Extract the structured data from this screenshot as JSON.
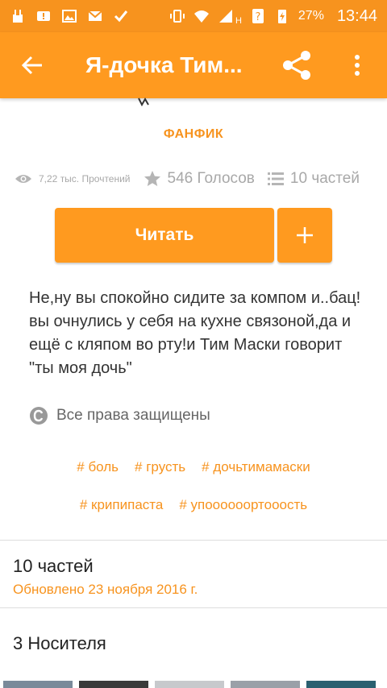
{
  "status_bar": {
    "battery": "27%",
    "time": "13:44",
    "network_label": "H",
    "icons": [
      "rock-hand-icon",
      "alert-icon",
      "image-icon",
      "gmail-icon",
      "check-icon",
      "vibrate-icon",
      "wifi-icon",
      "signal-icon",
      "question-icon",
      "battery-icon"
    ]
  },
  "app_bar": {
    "title": "Я-дочка Тим...",
    "icons": [
      "back-arrow-icon",
      "share-icon",
      "more-vert-icon"
    ]
  },
  "story": {
    "type": "ФАНФИК",
    "reads": "7,22 тыс. Прочтений",
    "votes": "546 Голосов",
    "parts": "10 частей",
    "read_button": "Читать",
    "add_button": "+",
    "description": "Не,ну вы спокойно сидите за компом и..бац!вы очнулись у себя на кухне связоной,да и ещё с кляпом во рту!и Тим Маски говорит \"ты моя дочь\"",
    "copyright": "Все права защищены",
    "tags_row1": [
      "# боль",
      "# грусть",
      "# дочьтимамаски"
    ],
    "tags_row2": [
      "# крипипаста",
      "# упоооооортооость"
    ]
  },
  "parts_section": {
    "title": "10 частей",
    "updated": "Обновлено 23 ноября 2016 г."
  },
  "readers_section": {
    "title": "3 Носителя"
  },
  "colors": {
    "accent": "#ff9a1f",
    "status_bar": "#f7931e",
    "muted": "#a8a8a8"
  }
}
